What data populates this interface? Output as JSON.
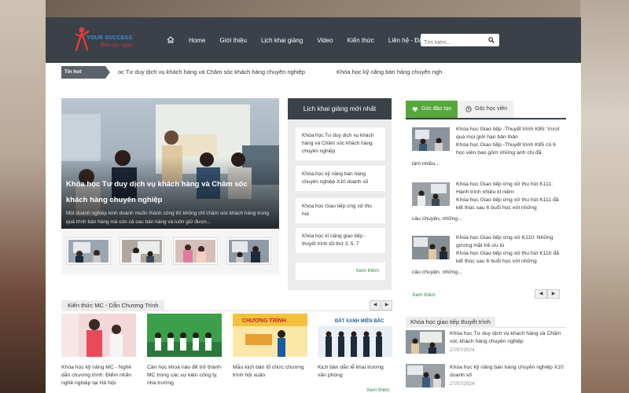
{
  "header": {
    "logo_brand": "YOUR SUCCESS",
    "logo_tag": "Đào tạo ngay",
    "nav": [
      "Home",
      "Giới thiệu",
      "Lịch khai giảng",
      "Video",
      "Kiến thức",
      "Liên hệ - Đăng ký"
    ],
    "search_placeholder": "Tìm kiếm..."
  },
  "ticker": {
    "label": "Tin hot",
    "items": [
      "oc Tư duy dịch vụ khách hàng và Chăm sóc khách hàng chuyên nghiệp",
      "Khóa học kỹ năng bán hàng chuyên ngh"
    ]
  },
  "slider": {
    "title": "Khóa học Tư duy dịch vụ khách hàng và Chăm sóc khách hàng chuyên nghiệp",
    "desc": "Một doanh nghiệp kinh doanh muốn thành công thì không chỉ chăm sóc khách hàng trong quá trình bán hàng mà còn cả sau bán hàng và luôn giữ được..."
  },
  "schedule": {
    "title": "Lịch khai giảng mới nhất",
    "items": [
      "Khóa học Tư duy dịch vụ khách hàng và Chăm sóc khách hàng chuyên nghiệp",
      "Khóa học kỹ năng bán hàng chuyên nghiệp X10 doanh số",
      "Khóa học Giao tiếp ứng xử thu hút",
      "Khóa học kĩ năng giao tiếp - thuyết trình tối thứ 3, 5, 7"
    ],
    "more": "Xem thêm"
  },
  "right_tabs": {
    "tab1": "Góc đào tạo",
    "tab2": "Góc học viên",
    "items": [
      {
        "title": "Khóa học Giao tiếp -Thuyết trình K85: Vượt qua mọi giới hạn bản thân",
        "body": "Khóa học Giao tiếp -Thuyết trình K85 có 6 học viên bao gồm những anh chị đã",
        "tail": "làm nhiều..."
      },
      {
        "title": "Khóa học Giao tiếp ứng xử thu hút K111: Hành trình nhiều kỉ niệm",
        "body": "Khóa học Giao tiếp ứng xử thu hút K111 đã kết thúc sau 6 buổi học với những",
        "tail": "câu chuyện, những..."
      },
      {
        "title": "Khóa học Giao tiếp ứng xử K110: Những gương mặt trẻ ưu tú",
        "body": "Khóa học Giao tiếp ứng xử thu hút K110 đã kết thúc sau 6 buổi học với những",
        "tail": "câu chuyện, những..."
      }
    ],
    "more": "Xem thêm"
  },
  "knowledge": {
    "title": "Kiến thức MC - Dẫn Chương Trình",
    "items": [
      "Khóa học kỹ năng MC - Nghề dẫn chương trình: Điểm nhấn nghề nghiệp tại Hà Nội",
      "Cần học khoá nào để trở thành MC trong các sự kiện công ty, nhà trường",
      "Mẫu kịch bản tổ chức chương trình hội xuân",
      "Kịch bản dẫn lễ khai trương văn phòng"
    ],
    "more": "Xem thêm",
    "banner_text": "CHƯƠNG TRÌNH",
    "sign_text": "ĐẤT XANH MIỀN BẮC"
  },
  "communication": {
    "title": "Khóa học giao tiếp thuyết trình",
    "items": [
      {
        "title": "Khóa học Tư duy dịch vụ khách hàng và Chăm sóc khách hàng chuyên nghiệp",
        "date": "27/07/2024"
      },
      {
        "title": "Khóa học kỹ năng bán hàng chuyên nghiệp X10 doanh số",
        "date": "27/07/2024"
      }
    ]
  }
}
